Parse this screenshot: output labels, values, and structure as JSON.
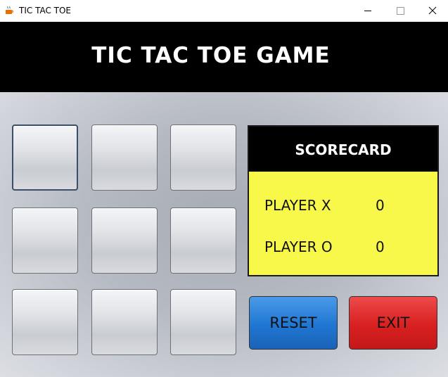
{
  "window": {
    "title": "TIC TAC TOE",
    "icons": {
      "app": "java-coffee-icon",
      "minimize": "minimize-icon",
      "maximize": "maximize-icon",
      "close": "close-icon"
    }
  },
  "header": {
    "title": "TIC TAC TOE GAME"
  },
  "board": {
    "cells": [
      "",
      "",
      "",
      "",
      "",
      "",
      "",
      "",
      ""
    ],
    "focused_cell": 0
  },
  "scorecard": {
    "title": "SCORECARD",
    "players": [
      {
        "label": "PLAYER X",
        "score": "0"
      },
      {
        "label": "PLAYER O",
        "score": "0"
      }
    ]
  },
  "buttons": {
    "reset": "RESET",
    "exit": "EXIT"
  },
  "colors": {
    "header_bg": "#000000",
    "scorecard_body": "#f7f84a",
    "reset_button": "#1f76d2",
    "exit_button": "#d82020"
  }
}
